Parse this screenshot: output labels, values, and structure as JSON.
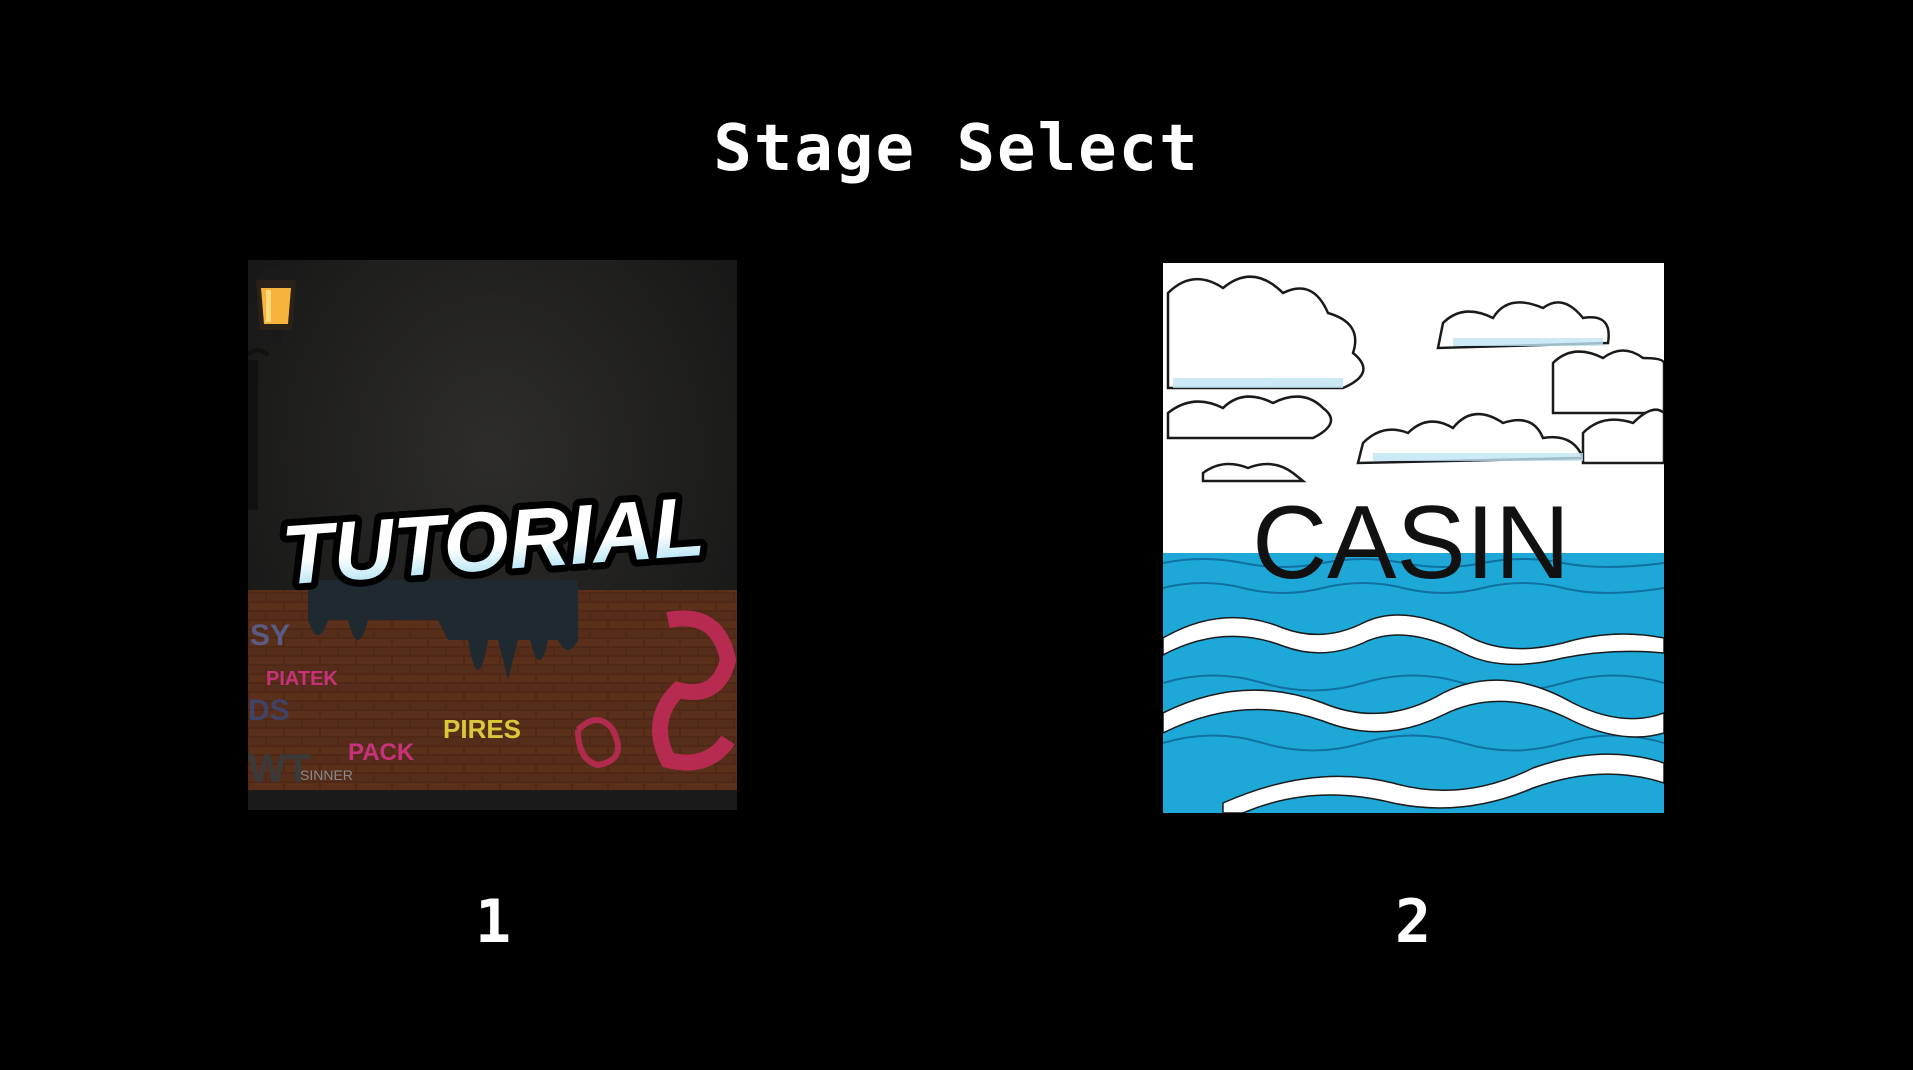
{
  "screen": {
    "title": "Stage Select",
    "background_color": "#000000"
  },
  "stages": [
    {
      "number": "1",
      "thumbnail_text": "TUTORIAL",
      "graffiti_tags": [
        "SY",
        "PIATEK",
        "DS",
        "PACK",
        "PIRES",
        "WT",
        "SINNER"
      ],
      "theme_colors": {
        "wall": "#8a4a2a",
        "sky": "#1c1c1c",
        "text_top": "#ffffff",
        "text_bottom": "#8fd8f0"
      }
    },
    {
      "number": "2",
      "thumbnail_text": "CASIN",
      "theme_colors": {
        "sky": "#ffffff",
        "sea": "#1ea8d8",
        "foam": "#ffffff",
        "text": "#111111"
      }
    }
  ]
}
